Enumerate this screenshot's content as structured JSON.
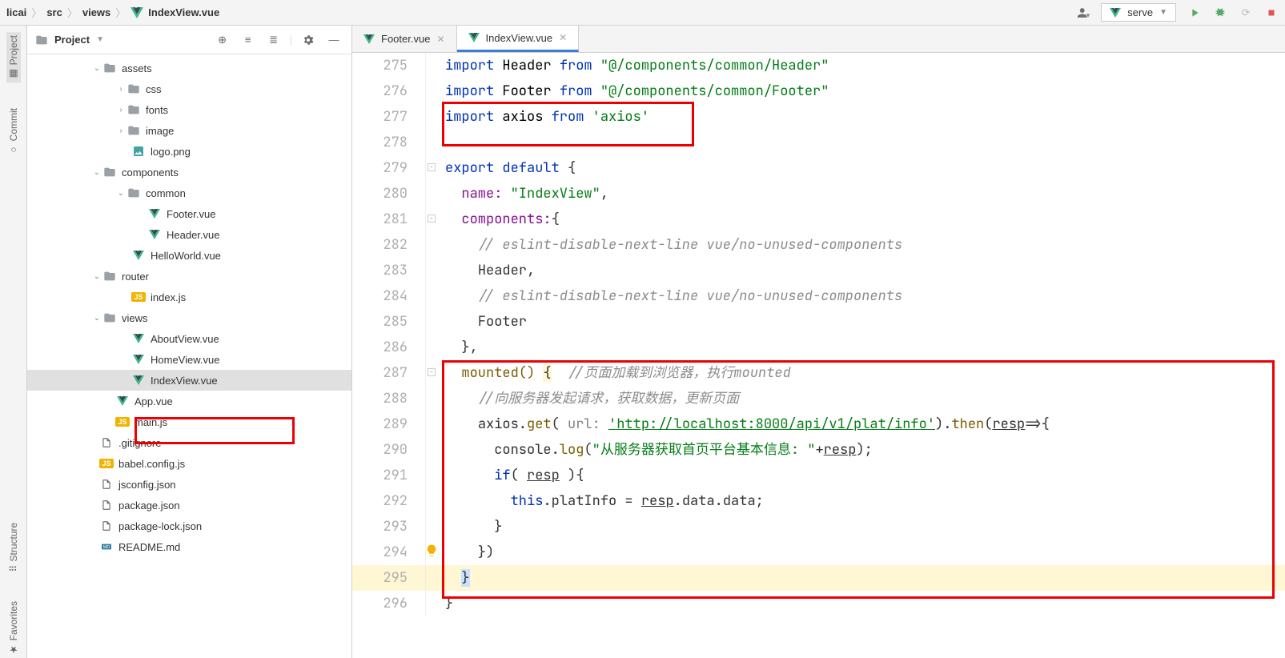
{
  "breadcrumb": [
    "licai",
    "src",
    "views",
    "IndexView.vue"
  ],
  "run_config": "serve",
  "left_tabs": [
    "Project",
    "Commit",
    "Structure",
    "Favorites"
  ],
  "project_panel": {
    "title": "Project"
  },
  "tree": {
    "assets": "assets",
    "css": "css",
    "fonts": "fonts",
    "image": "image",
    "logo": "logo.png",
    "components": "components",
    "common": "common",
    "footer": "Footer.vue",
    "header": "Header.vue",
    "hello": "HelloWorld.vue",
    "router": "router",
    "indexjs": "index.js",
    "views": "views",
    "about": "AboutView.vue",
    "home": "HomeView.vue",
    "indexview": "IndexView.vue",
    "appvue": "App.vue",
    "mainjs": "main.js",
    "gitignore": ".gitignore",
    "babel": "babel.config.js",
    "jsconfig": "jsconfig.json",
    "package": "package.json",
    "packagelock": "package-lock.json",
    "readme": "README.md"
  },
  "editor_tabs": [
    {
      "label": "Footer.vue",
      "active": false
    },
    {
      "label": "IndexView.vue",
      "active": true
    }
  ],
  "code": {
    "l275": {
      "kw1": "import",
      "id": "Header",
      "kw2": "from",
      "str": "\"@/components/common/Header\""
    },
    "l276": {
      "kw1": "import",
      "id": "Footer",
      "kw2": "from",
      "str": "\"@/components/common/Footer\""
    },
    "l277": {
      "kw1": "import",
      "id": "axios",
      "kw2": "from",
      "str": "'axios'"
    },
    "l279": {
      "kw1": "export",
      "kw2": "default",
      "brace": "{"
    },
    "l280": {
      "prop": "name:",
      "str": "\"IndexView\"",
      "comma": ","
    },
    "l281": {
      "prop": "components:",
      "brace": "{"
    },
    "l282": {
      "comment": "// eslint-disable-next-line vue/no-unused-components"
    },
    "l283": {
      "id": "Header,"
    },
    "l284": {
      "comment": "// eslint-disable-next-line vue/no-unused-components"
    },
    "l285": {
      "id": "Footer"
    },
    "l286": {
      "brace": "},"
    },
    "l287": {
      "fn": "mounted()",
      "brace": "{",
      "comment": "//页面加载到浏览器，执行mounted"
    },
    "l288": {
      "comment": "//向服务器发起请求，获取数据，更新页面"
    },
    "l289": {
      "id": "axios.",
      "fn": "get",
      "paren": "(",
      "plabel": " url: ",
      "url": "'http://localhost:8000/api/v1/plat/info'",
      "tail": ").",
      "fn2": "then",
      "paren2": "(",
      "arg": "resp",
      "arrow": "=>{",
      "close": ""
    },
    "l290": {
      "id": "console.",
      "fn": "log",
      "paren": "(",
      "str": "\"从服务器获取首页平台基本信息: \"",
      "plus": "+",
      "var": "resp",
      "close": ");"
    },
    "l291": {
      "kw": "if",
      "paren": "( ",
      "var": "resp",
      "close": " ){"
    },
    "l292": {
      "thiskw": "this",
      "dot": ".platInfo = ",
      "var": "resp",
      "tail": ".data.data;"
    },
    "l293": {
      "brace": "}"
    },
    "l294": {
      "brace": "})"
    },
    "l295": {
      "brace": "}"
    },
    "l296": {
      "brace": "}"
    }
  },
  "linenos": {
    "275": "275",
    "276": "276",
    "277": "277",
    "278": "278",
    "279": "279",
    "280": "280",
    "281": "281",
    "282": "282",
    "283": "283",
    "284": "284",
    "285": "285",
    "286": "286",
    "287": "287",
    "288": "288",
    "289": "289",
    "290": "290",
    "291": "291",
    "292": "292",
    "293": "293",
    "294": "294",
    "295": "295",
    "296": "296"
  }
}
